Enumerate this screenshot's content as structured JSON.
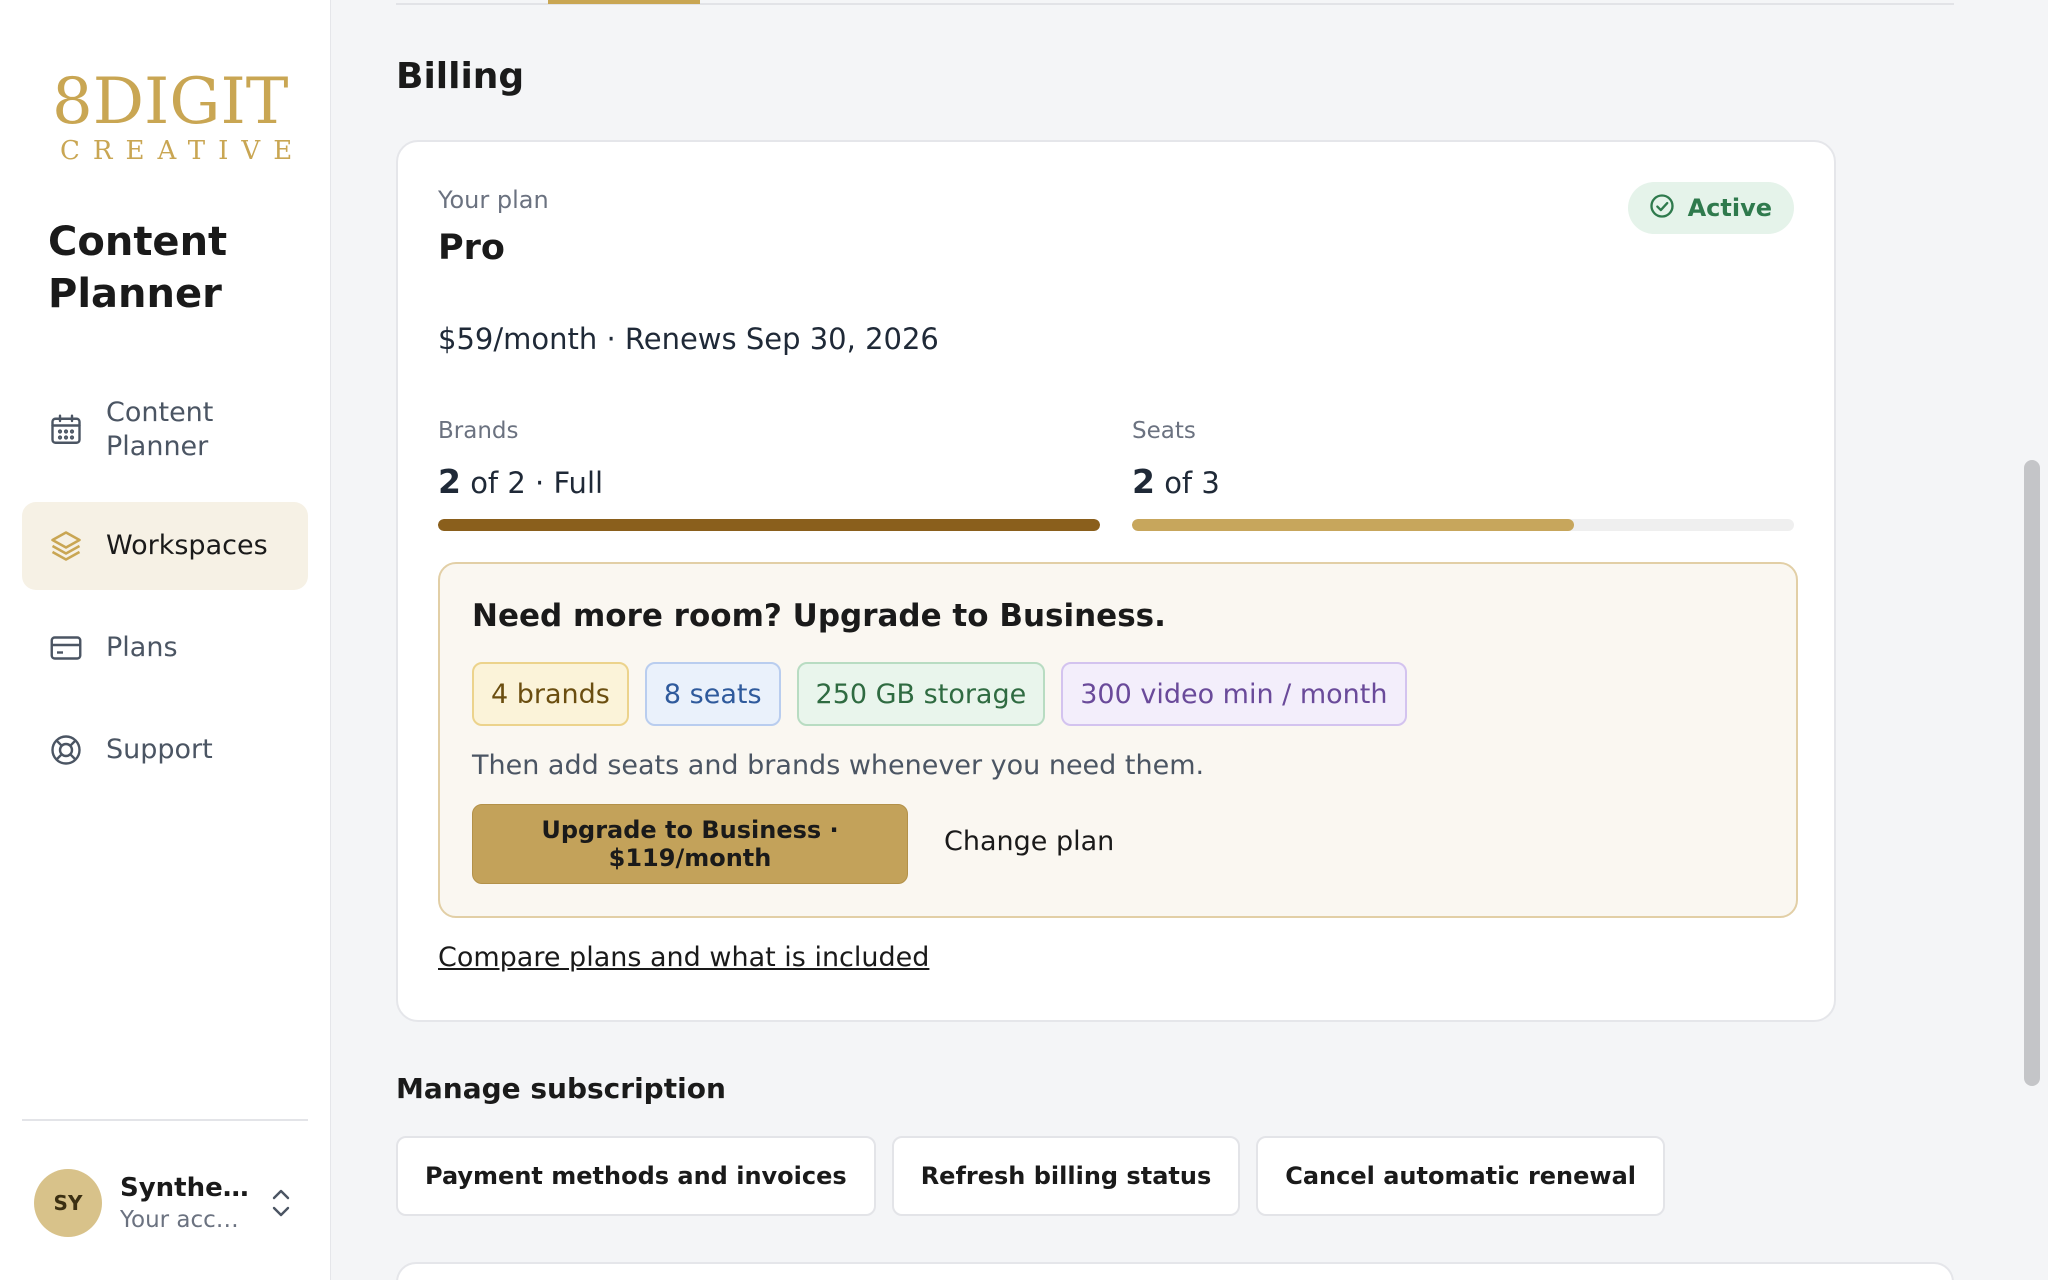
{
  "sidebar": {
    "logo_line1": "8DIGIT",
    "logo_line2": "CREATIVE",
    "app_title": "Content Planner",
    "nav": [
      {
        "label": "Content Planner",
        "icon": "calendar-icon"
      },
      {
        "label": "Workspaces",
        "icon": "layers-icon",
        "active": true
      },
      {
        "label": "Plans",
        "icon": "credit-card-icon"
      },
      {
        "label": "Support",
        "icon": "lifebuoy-icon"
      }
    ],
    "user": {
      "initials": "SY",
      "name": "Syntheti…",
      "subtitle": "Your acco…"
    }
  },
  "billing": {
    "heading": "Billing",
    "plan_label": "Your plan",
    "plan_name": "Pro",
    "status": "Active",
    "price_line": "$59/month · Renews Sep 30, 2026",
    "brands": {
      "label": "Brands",
      "used": "2",
      "rest": "of 2 · Full",
      "fraction": 1.0,
      "color": "#8a5f1c"
    },
    "seats": {
      "label": "Seats",
      "used": "2",
      "rest": "of 3",
      "fraction": 0.667,
      "color": "#c7a65c"
    },
    "upsell": {
      "title": "Need more room? Upgrade to Business.",
      "chips": [
        {
          "label": "4 brands",
          "bg": "#fbf3d9",
          "border": "#ecd38c",
          "color": "#6b4e10"
        },
        {
          "label": "8 seats",
          "bg": "#eaf1fb",
          "border": "#b9cdef",
          "color": "#2f5a9c"
        },
        {
          "label": "250 GB storage",
          "bg": "#e9f5ec",
          "border": "#b8dcc2",
          "color": "#2f6b41"
        },
        {
          "label": "300 video min / month",
          "bg": "#f3eefb",
          "border": "#d3c3ef",
          "color": "#6a4a9a"
        }
      ],
      "note": "Then add seats and brands whenever you need them.",
      "upgrade_button": "Upgrade to Business · $119/month",
      "change_plan": "Change plan"
    },
    "compare_link": "Compare plans and what is included"
  },
  "manage": {
    "heading": "Manage subscription",
    "buttons": [
      "Payment methods and invoices",
      "Refresh billing status",
      "Cancel automatic renewal"
    ]
  },
  "colors": {
    "accent": "#c9a653",
    "active_badge": "#2f7a4d"
  }
}
